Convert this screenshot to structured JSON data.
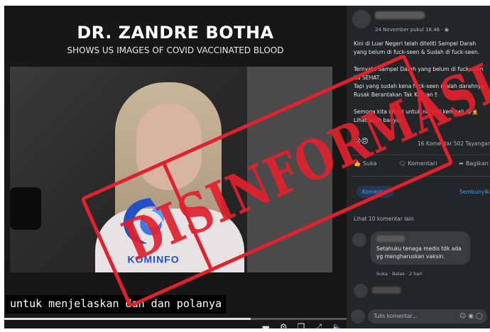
{
  "video": {
    "title": "DR. ZANDRE BOTHA",
    "subtitle": "SHOWS US IMAGES OF COVID VACCINATED BLOOD",
    "caption": "untuk menjelaskan dan dan polanya",
    "progress": 0.72,
    "control_icons": [
      "caption-icon",
      "settings-icon",
      "miniplayer-icon",
      "fullscreen-icon",
      "volume-icon"
    ]
  },
  "post": {
    "time": "24 November pukul 18.46 · ",
    "text_lines": [
      "Kini di Luar Negeri telah diteliti Sampel Darah",
      "yang belum di fuck-seen & Sudah di fuck-seen.",
      "",
      "Ternyata Sampel Darah yang belum di fuck-seen",
      "itu SEHAT,",
      "Tapi yang sudah kena fuck-seen malah darahnya",
      "Rusak Berantakan Tak Karuan ‼",
      "",
      "Semoga kita diberi untuk normal kembali 😭🤦",
      "Lihat lebih banyak"
    ],
    "stats": "16 Komentar   502 Tayangan",
    "actions": {
      "like": "Suka",
      "comment": "Komentari",
      "share": "Bagikan"
    },
    "tabs": {
      "comments": "Komentar",
      "hide": "Sembunyikan"
    },
    "more_comments": "Lihat 10 komentar lain",
    "comment": {
      "text": "Setahuku tenaga medis tdk ada yg mengharuskan vaksin.",
      "meta": "Suka · Balas · 2 hari"
    },
    "composer_placeholder": "Tulis komentar..."
  },
  "stamp": {
    "word": "DISINFORMASI",
    "color": "#e2202e",
    "logo_text": "KOMINFO"
  }
}
